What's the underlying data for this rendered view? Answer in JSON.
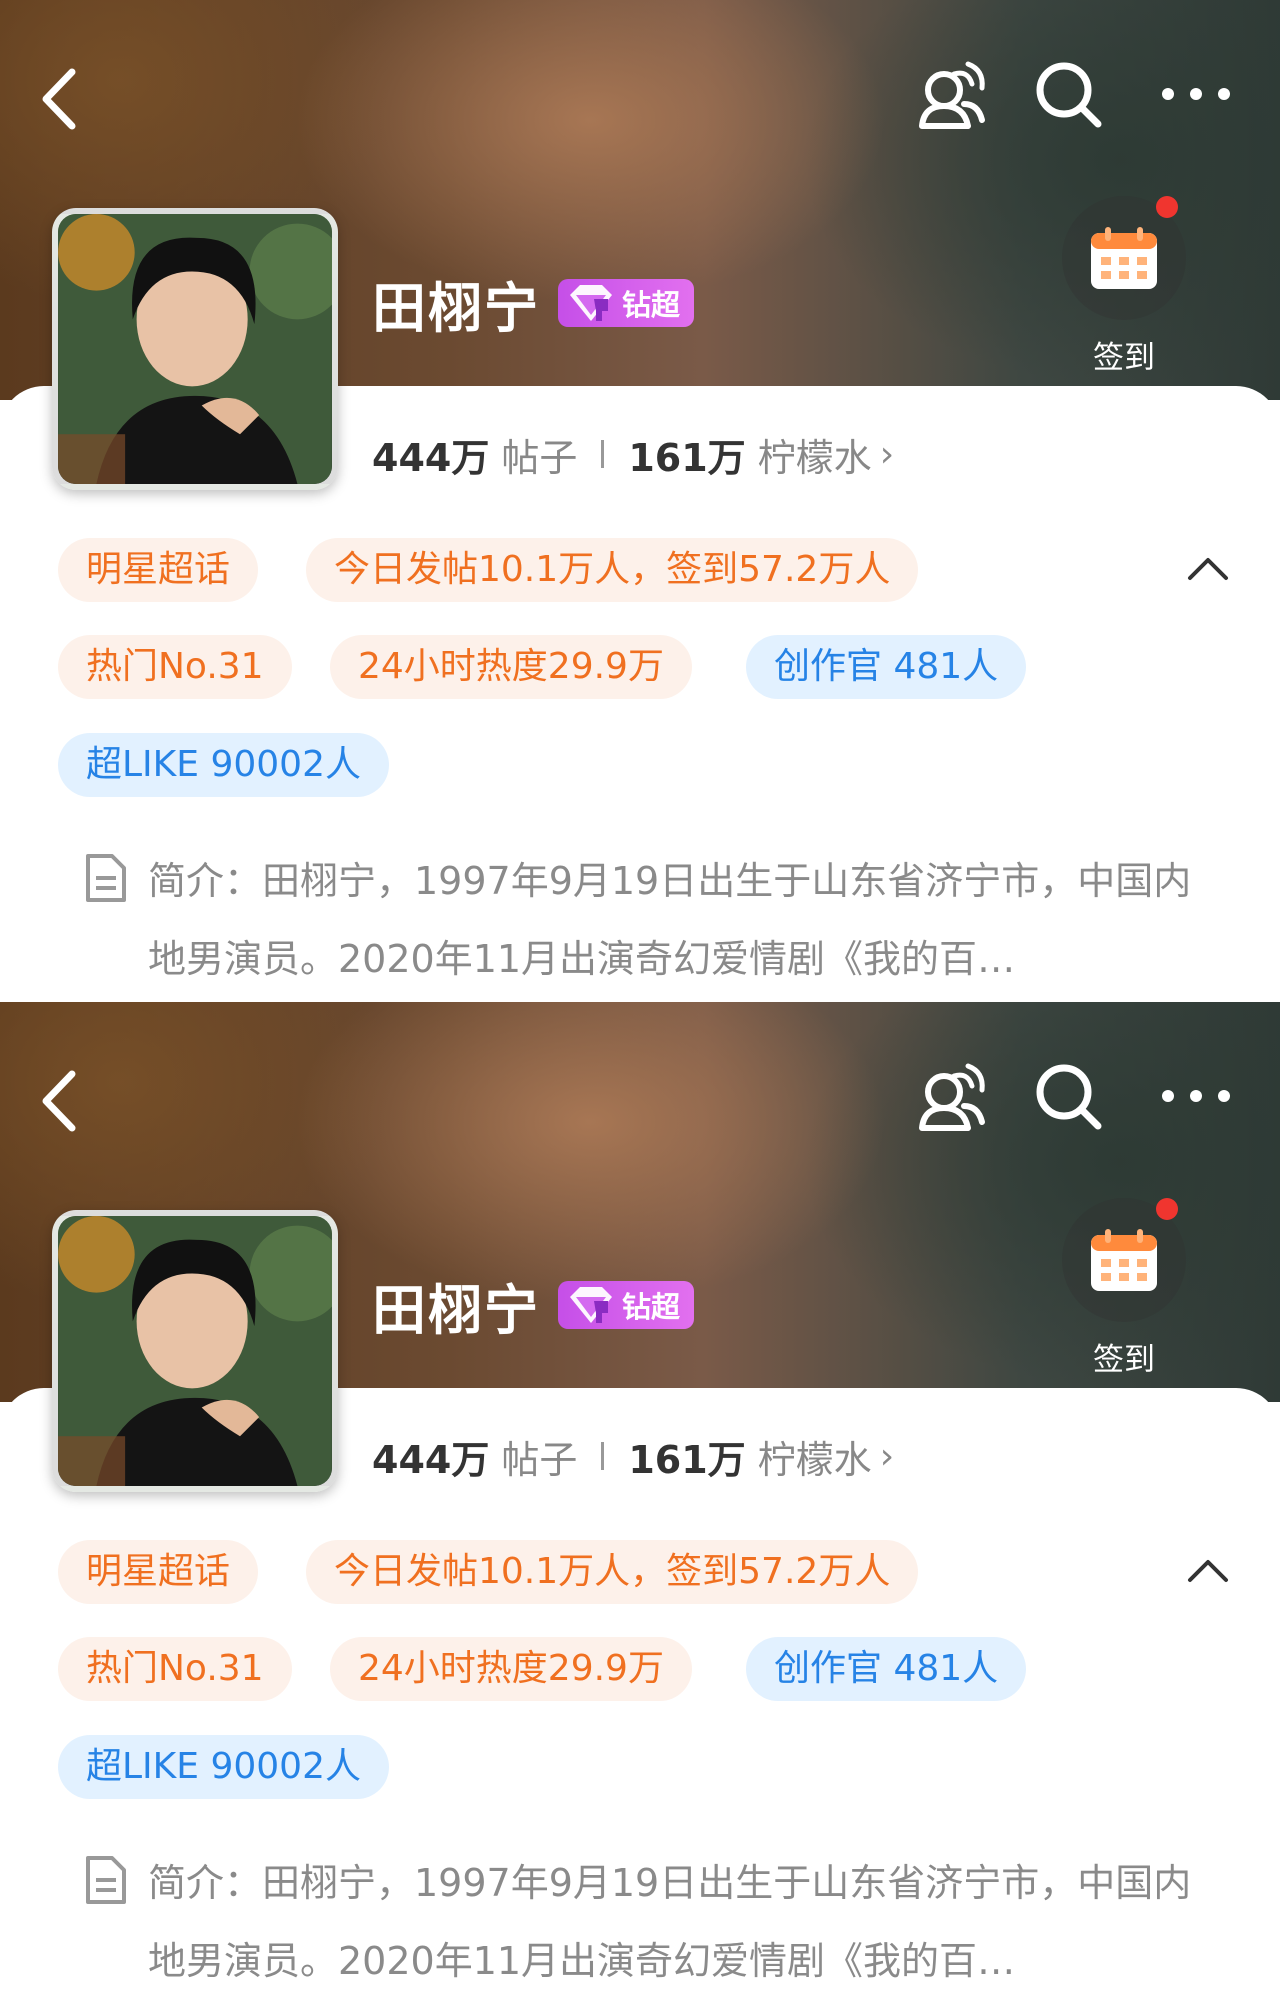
{
  "profile": {
    "name": "田栩宁",
    "badge": "钻超",
    "checkin_label": "签到",
    "stats": {
      "posts_value": "444万",
      "posts_label": "帖子",
      "fans_value": "161万",
      "fans_label": "柠檬水"
    },
    "tags": {
      "category": "明星超话",
      "today": "今日发帖10.1万人，签到57.2万人",
      "rank": "热门No.31",
      "heat": "24小时热度29.9万",
      "creators": "创作官 481人",
      "superlike": "超LIKE 90002人"
    },
    "intro": "简介：田栩宁，1997年9月19日出生于山东省济宁市，中国内地男演员。2020年11月出演奇幻爱情剧《我的百…"
  },
  "colors": {
    "orange_tag_bg": "#fdf1ea",
    "orange_tag_text": "#f07020",
    "blue_tag_bg": "#e2f1ff",
    "blue_tag_text": "#2683e6",
    "badge_purple": "#c54fe8",
    "red_dot": "#f0352f"
  },
  "icons": [
    "back-icon",
    "chat-icon",
    "search-icon",
    "more-icon",
    "calendar-icon",
    "diamond-icon",
    "chevron-up-icon",
    "document-icon"
  ]
}
